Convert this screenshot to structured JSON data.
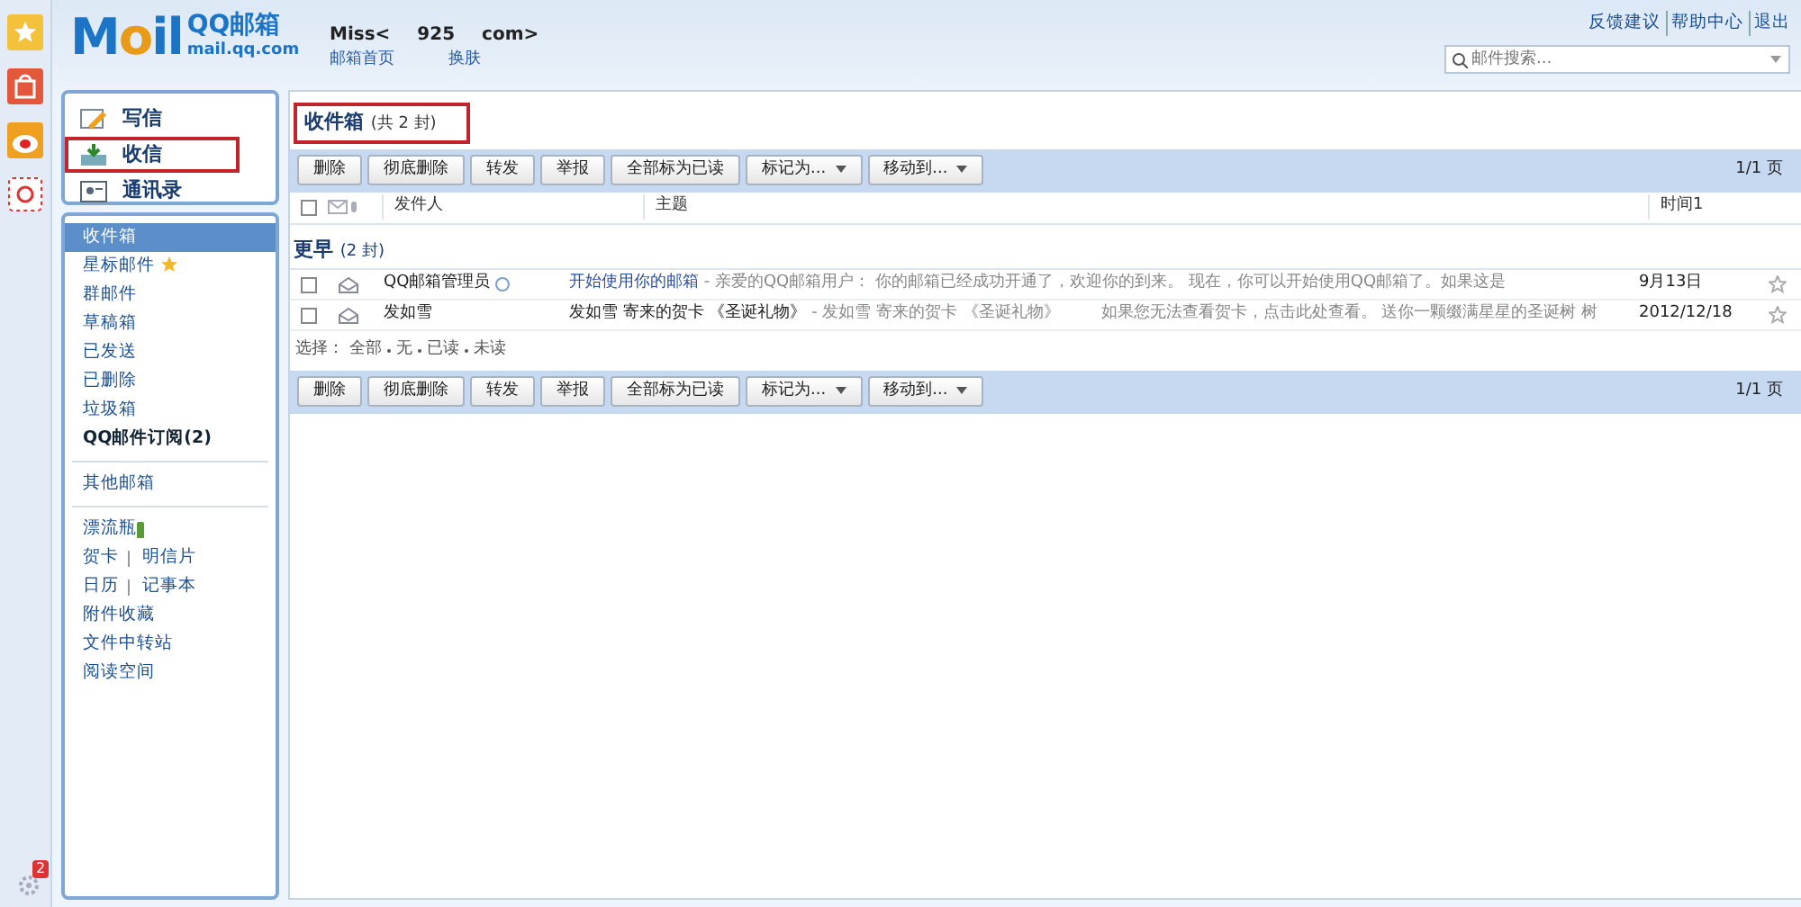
{
  "logo": {
    "mark": [
      {
        "text": "M",
        "color": "#1b74c5"
      },
      {
        "text": "o",
        "color": "#e89a1a"
      },
      {
        "text": "il",
        "color": "#1b74c5"
      }
    ],
    "brand": "QQ邮箱",
    "domain": "mail.qq.com"
  },
  "account": {
    "name": "Miss<",
    "address_parts": [
      "925",
      "com>"
    ],
    "links": [
      "邮箱首页",
      "换肤"
    ]
  },
  "top_links": [
    "反馈建议",
    "帮助中心",
    "退出"
  ],
  "search": {
    "placeholder": "邮件搜索..."
  },
  "rail_icons": [
    {
      "kind": "star"
    },
    {
      "kind": "shop"
    },
    {
      "kind": "weibo"
    },
    {
      "kind": "at"
    }
  ],
  "rail_badge": "2",
  "actions": [
    {
      "label": "写信",
      "kind": "write",
      "selected": false,
      "highlighted": false
    },
    {
      "label": "收信",
      "kind": "receive",
      "selected": false,
      "highlighted": true
    },
    {
      "label": "通讯录",
      "kind": "contacts",
      "selected": false,
      "highlighted": false
    }
  ],
  "folders": [
    {
      "label": "收件箱",
      "selected": true,
      "bold": false,
      "starred": false
    },
    {
      "label": "星标邮件",
      "selected": false,
      "bold": false,
      "starred": true
    },
    {
      "label": "群邮件",
      "selected": false,
      "bold": false,
      "starred": false
    },
    {
      "label": "草稿箱",
      "selected": false,
      "bold": false,
      "starred": false
    },
    {
      "label": "已发送",
      "selected": false,
      "bold": false,
      "starred": false
    },
    {
      "label": "已删除",
      "selected": false,
      "bold": false,
      "starred": false
    },
    {
      "label": "垃圾箱",
      "selected": false,
      "bold": false,
      "starred": false
    },
    {
      "label": "QQ邮件订阅(2)",
      "selected": false,
      "bold": true,
      "starred": false
    }
  ],
  "other_folder": "其他邮箱",
  "apps": [
    [
      "漂流瓶"
    ],
    [
      "贺卡",
      "明信片"
    ],
    [
      "日历",
      "记事本"
    ],
    [
      "附件收藏"
    ],
    [
      "文件中转站"
    ],
    [
      "阅读空间"
    ]
  ],
  "title": {
    "name": "收件箱",
    "count": "(共 2 封)",
    "highlighted": true
  },
  "toolbar": [
    {
      "label": "删除",
      "dropdown": false
    },
    {
      "label": "彻底删除",
      "dropdown": false
    },
    {
      "label": "转发",
      "dropdown": false
    },
    {
      "label": "举报",
      "dropdown": false
    },
    {
      "label": "全部标为已读",
      "dropdown": false
    },
    {
      "label": "标记为...",
      "dropdown": true
    },
    {
      "label": "移动到...",
      "dropdown": true
    }
  ],
  "pager": "1/1 页",
  "select_all": {
    "checked": false
  },
  "columns": [
    "发件人",
    "主题",
    "时间1"
  ],
  "group": {
    "label": "更早",
    "count": "(2 封)"
  },
  "rows": [
    {
      "sender": "QQ邮箱管理员",
      "verified": true,
      "subject": "开始使用你的邮箱",
      "preview": "- 亲爱的QQ邮箱用户： 你的邮箱已经成功开通了，欢迎你的到来。 现在，你可以开始使用QQ邮箱了。如果这是",
      "time": "9月13日",
      "checked": false,
      "starred": false
    },
    {
      "sender": "发如雪",
      "verified": false,
      "subject": "发如雪 寄来的贺卡 《圣诞礼物》",
      "preview": "- 发如雪 寄来的贺卡 《圣诞礼物》        如果您无法查看贺卡，点击此处查看。 送你一颗缀满星星的圣诞树 树",
      "time": "2012/12/18",
      "checked": false,
      "starred": false
    }
  ],
  "select": {
    "label": "选择：",
    "options": [
      "全部",
      "无",
      "已读",
      "未读"
    ]
  },
  "bottom_toolbar": [
    {
      "label": "删除",
      "dropdown": false
    },
    {
      "label": "彻底删除",
      "dropdown": false
    },
    {
      "label": "转发",
      "dropdown": false
    },
    {
      "label": "举报",
      "dropdown": false
    },
    {
      "label": "全部标为已读",
      "dropdown": false
    },
    {
      "label": "标记为...",
      "dropdown": true
    },
    {
      "label": "移动到...",
      "dropdown": true
    }
  ],
  "bottom_pager": "1/1 页"
}
